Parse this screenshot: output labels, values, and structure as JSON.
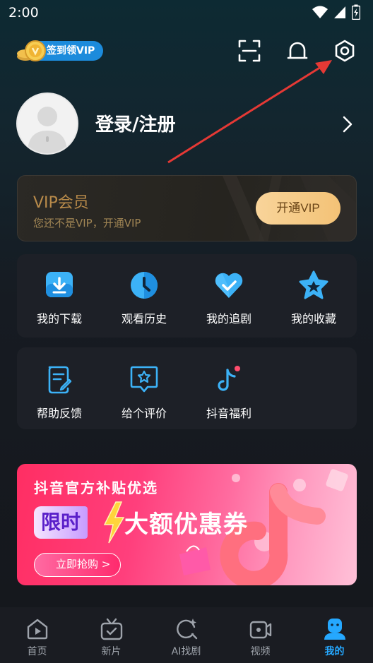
{
  "status_bar": {
    "time": "2:00"
  },
  "top_bar": {
    "vip_sign_label": "签到领VIP"
  },
  "profile": {
    "login_label": "登录/注册"
  },
  "vip_card": {
    "title": "VIP会员",
    "subtitle": "您还不是VIP，开通VIP",
    "button_label": "开通VIP"
  },
  "quick_grid": {
    "items": [
      {
        "label": "我的下载",
        "icon": "download-icon"
      },
      {
        "label": "观看历史",
        "icon": "history-clock-icon"
      },
      {
        "label": "我的追剧",
        "icon": "heart-check-icon"
      },
      {
        "label": "我的收藏",
        "icon": "star-icon"
      }
    ]
  },
  "service_grid": {
    "items": [
      {
        "label": "帮助反馈",
        "icon": "feedback-icon"
      },
      {
        "label": "给个评价",
        "icon": "rate-icon"
      },
      {
        "label": "抖音福利",
        "icon": "douyin-icon"
      }
    ]
  },
  "banner": {
    "title": "抖音官方补贴优选",
    "tag": "限时",
    "headline": "大额优惠券",
    "button_label": "立即抢购 >"
  },
  "tab_bar": {
    "tabs": [
      {
        "label": "首页",
        "icon": "home-play-icon",
        "active": false
      },
      {
        "label": "新片",
        "icon": "new-tv-icon",
        "active": false
      },
      {
        "label": "AI找剧",
        "icon": "ai-search-icon",
        "active": false
      },
      {
        "label": "视频",
        "icon": "video-camera-icon",
        "active": false
      },
      {
        "label": "我的",
        "icon": "profile-icon",
        "active": true
      }
    ]
  },
  "colors": {
    "accent": "#25a8ff",
    "vip_gold": "#f3c276",
    "banner_pink": "#ff2e63"
  }
}
